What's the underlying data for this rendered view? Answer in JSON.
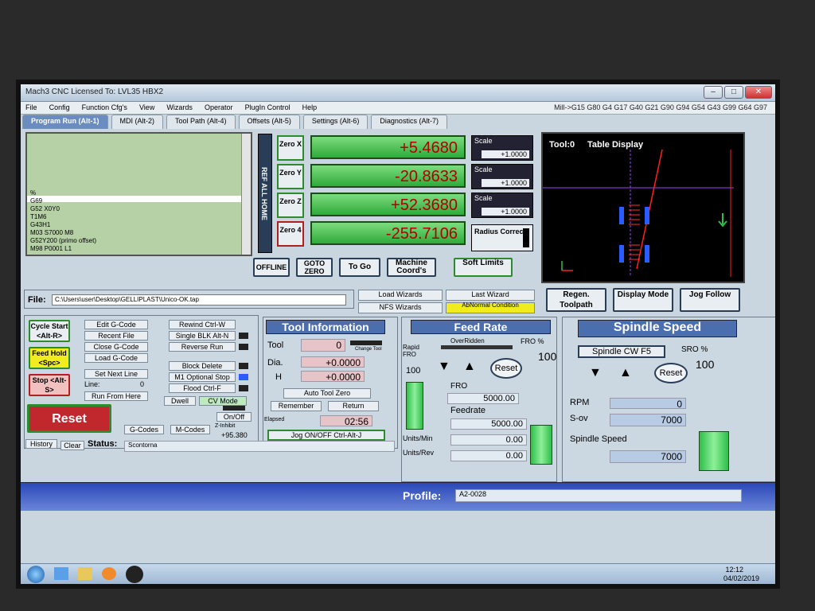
{
  "window": {
    "title": "Mach3 CNC Licensed To: LVL35 HBX2"
  },
  "menu": [
    "File",
    "Config",
    "Function Cfg's",
    "View",
    "Wizards",
    "Operator",
    "PlugIn Control",
    "Help"
  ],
  "modeline": "Mill->G15  G80 G4 G17 G40 G21 G90 G94 G54 G43 G99 G64 G97",
  "tabs": [
    "Program Run (Alt-1)",
    "MDI (Alt-2)",
    "Tool Path (Alt-4)",
    "Offsets (Alt-5)",
    "Settings (Alt-6)",
    "Diagnostics (Alt-7)"
  ],
  "gcode_lines": [
    "%",
    "G69",
    "G52 X0Y0",
    "T1M6",
    "G43H1",
    "M03 S7000 M8",
    "G52Y200 (primo offset)",
    "M98 P0001 L1"
  ],
  "ref_all_home": "REF ALL HOME",
  "axes": [
    {
      "zero": "Zero X",
      "value": "+5.4680",
      "scale": "+1.0000"
    },
    {
      "zero": "Zero Y",
      "value": "-20.8633",
      "scale": "+1.0000"
    },
    {
      "zero": "Zero Z",
      "value": "+52.3680",
      "scale": "+1.0000"
    },
    {
      "zero": "Zero 4",
      "value": "-255.7106"
    }
  ],
  "scale_label": "Scale",
  "radius_correct": "Radius Correct",
  "dro_buttons": {
    "offline": "OFFLINE",
    "goto_zero": "GOTO ZERO",
    "to_go": "To Go",
    "machine_coords": "Machine Coord's",
    "soft_limits": "Soft Limits"
  },
  "table_display": {
    "tool": "Tool:0",
    "title": "Table Display"
  },
  "file": {
    "label": "File:",
    "path": "C:\\Users\\user\\Desktop\\GELLIPLAST\\Unico-OK.tap"
  },
  "wizards": {
    "load": "Load Wizards",
    "last": "Last Wizard",
    "nfs": "NFS Wizards",
    "abnormal": "AbNormal Condition"
  },
  "toolpath_buttons": {
    "regen": "Regen. Toolpath",
    "display_mode": "Display Mode",
    "jog_follow": "Jog Follow"
  },
  "run_controls": {
    "cycle_start": "Cycle Start <Alt-R>",
    "feed_hold": "Feed Hold <Spc>",
    "stop": "Stop <Alt-S>",
    "edit_gcode": "Edit G-Code",
    "recent_file": "Recent File",
    "close_gcode": "Close G-Code",
    "load_gcode": "Load G-Code",
    "set_next_line": "Set Next Line",
    "line_label": "Line:",
    "line_value": "0",
    "run_from_here": "Run From Here",
    "rewind": "Rewind Ctrl-W",
    "single_blk": "Single BLK Alt-N",
    "reverse_run": "Reverse Run",
    "block_delete": "Block Delete",
    "m1_optional": "M1 Optional Stop",
    "flood": "Flood Ctrl-F",
    "dwell": "Dwell",
    "cv_mode": "CV Mode",
    "reset": "Reset",
    "gcodes": "G-Codes",
    "mcodes": "M-Codes",
    "on_off": "On/Off",
    "z_inhibit": "Z-Inhibit",
    "z_inhibit_value": "+95.380"
  },
  "tool_info": {
    "header": "Tool Information",
    "tool_label": "Tool",
    "tool_value": "0",
    "change": "Change Tool",
    "dia_label": "Dia.",
    "dia_value": "+0.0000",
    "h_label": "H",
    "h_value": "+0.0000",
    "auto_tool_zero": "Auto Tool Zero",
    "remember": "Remember",
    "return": "Return",
    "elapsed_label": "Elapsed",
    "elapsed_value": "02:56",
    "jog": "Jog ON/OFF Ctrl-Alt-J"
  },
  "feed": {
    "header": "Feed Rate",
    "overridden": "OverRidden",
    "fro_pct_label": "FRO %",
    "fro_pct_value": "100",
    "rapid_fro": "Rapid FRO",
    "rapid_value": "100",
    "reset": "Reset",
    "fro_label": "FRO",
    "fro_value": "5000.00",
    "feedrate_label": "Feedrate",
    "feedrate_value": "5000.00",
    "units_min_label": "Units/Min",
    "units_min_value": "0.00",
    "units_rev_label": "Units/Rev",
    "units_rev_value": "0.00"
  },
  "spindle": {
    "header": "Spindle Speed",
    "cw": "Spindle CW F5",
    "sro_label": "SRO %",
    "sro_value": "100",
    "reset": "Reset",
    "rpm_label": "RPM",
    "rpm_value": "0",
    "sov_label": "S-ov",
    "sov_value": "7000",
    "speed_label": "Spindle Speed",
    "speed_value": "7000"
  },
  "status": {
    "history": "History",
    "clear": "Clear",
    "label": "Status:",
    "text": "Scontorna",
    "profile_label": "Profile:",
    "profile_value": "A2-0028"
  },
  "clock": {
    "time": "12:12",
    "date": "04/02/2019"
  },
  "colors": {
    "dro_green": "#3fbf4a",
    "header_blue": "#4b6fae",
    "reset_red": "#c0282e"
  }
}
